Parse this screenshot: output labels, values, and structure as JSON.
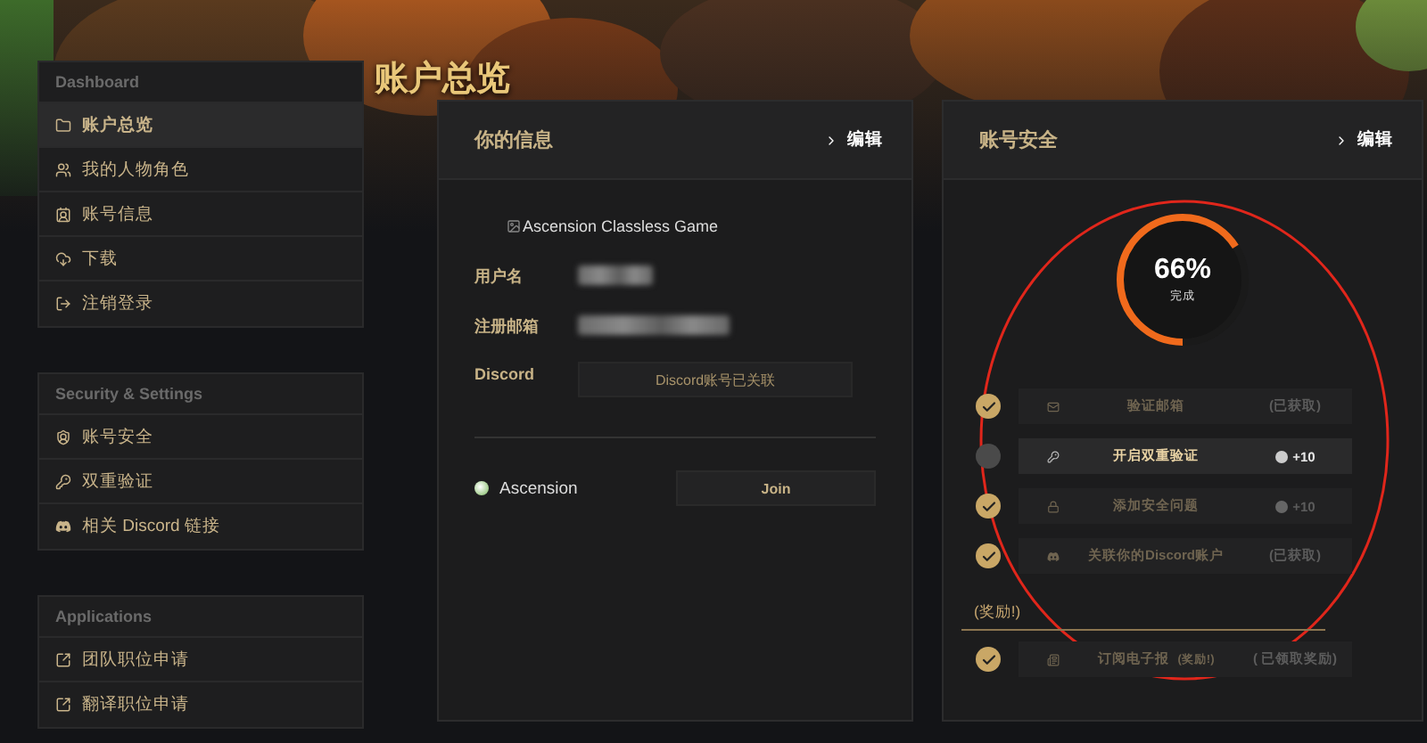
{
  "page_title": "账户总览",
  "sidebar": [
    {
      "heading": "Dashboard",
      "items": [
        {
          "label": "账户总览",
          "selected": true
        },
        {
          "label": "我的人物角色",
          "selected": false
        },
        {
          "label": "账号信息",
          "selected": false
        },
        {
          "label": "下载",
          "selected": false
        },
        {
          "label": "注销登录",
          "selected": false
        }
      ]
    },
    {
      "heading": "Security & Settings",
      "items": [
        {
          "label": "账号安全",
          "selected": false
        },
        {
          "label": "双重验证",
          "selected": false
        },
        {
          "label": "相关 Discord 链接",
          "selected": false
        }
      ]
    },
    {
      "heading": "Applications",
      "items": [
        {
          "label": "团队职位申请",
          "selected": false
        },
        {
          "label": "翻译职位申请",
          "selected": false
        }
      ]
    }
  ],
  "info_panel": {
    "title": "你的信息",
    "edit": "编辑",
    "image_alt": "Ascension Classless Game",
    "fields": [
      {
        "label": "用户名",
        "kind": "hidden"
      },
      {
        "label": "注册邮箱",
        "kind": "hidden"
      },
      {
        "label": "Discord",
        "kind": "box",
        "value": "Discord账号已关联"
      }
    ],
    "server": {
      "name": "Ascension",
      "button": "Join"
    }
  },
  "security_panel": {
    "title": "账号安全",
    "edit": "编辑",
    "progress": {
      "percent": "66%",
      "caption": "完成",
      "level": 0.66
    },
    "tasks": [
      {
        "label": "验证邮箱",
        "done": true,
        "active": false,
        "reward": {
          "kind": "claimed",
          "text": "(已获取)"
        }
      },
      {
        "label": "开启双重验证",
        "done": false,
        "active": true,
        "reward": {
          "kind": "points",
          "text": "+10"
        }
      },
      {
        "label": "添加安全问题",
        "done": true,
        "active": false,
        "reward": {
          "kind": "points",
          "text": "+10"
        }
      },
      {
        "label": "关联你的Discord账户",
        "done": true,
        "active": false,
        "reward": {
          "kind": "claimed",
          "text": "(已获取)"
        }
      }
    ],
    "bonus_heading": "(奖励!)",
    "bonus_tasks": [
      {
        "label": "订阅电子报",
        "tag": "(奖励!)",
        "done": true,
        "active": false,
        "reward": {
          "kind": "claimed",
          "text": "( 已领取奖励)"
        }
      }
    ],
    "annotation": {
      "kind": "ellipse",
      "color": "#e0261b"
    }
  }
}
